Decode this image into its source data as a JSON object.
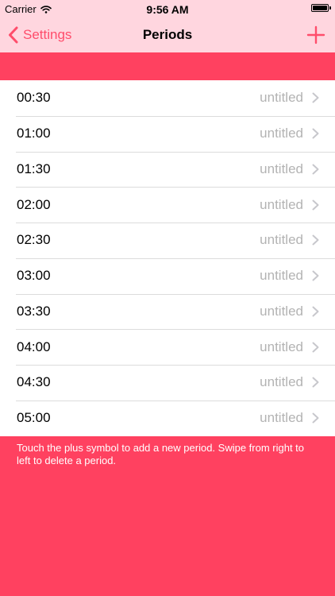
{
  "status": {
    "carrier": "Carrier",
    "time": "9:56 AM"
  },
  "nav": {
    "back_label": "Settings",
    "title": "Periods"
  },
  "periods": [
    {
      "time": "00:30",
      "label": "untitled"
    },
    {
      "time": "01:00",
      "label": "untitled"
    },
    {
      "time": "01:30",
      "label": "untitled"
    },
    {
      "time": "02:00",
      "label": "untitled"
    },
    {
      "time": "02:30",
      "label": "untitled"
    },
    {
      "time": "03:00",
      "label": "untitled"
    },
    {
      "time": "03:30",
      "label": "untitled"
    },
    {
      "time": "04:00",
      "label": "untitled"
    },
    {
      "time": "04:30",
      "label": "untitled"
    },
    {
      "time": "05:00",
      "label": "untitled"
    }
  ],
  "footer": {
    "hint": "Touch the plus symbol to add a new period. Swipe from right to left to delete a period."
  },
  "colors": {
    "accent": "#ff4160",
    "tint": "#ff4d6b",
    "nav_background": "#ffd6df"
  },
  "icons": {
    "back": "chevron-left-icon",
    "add": "plus-icon",
    "row": "chevron-right-icon",
    "wifi": "wifi-icon",
    "battery": "battery-icon"
  }
}
